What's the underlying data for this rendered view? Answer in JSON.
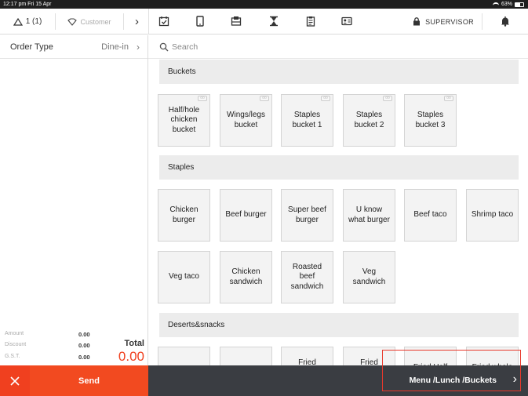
{
  "status_bar": {
    "time_date": "12:17 pm  Fri 15 Apr",
    "battery": "63%",
    "battery_level": 0.63
  },
  "topbar": {
    "table_label": "1 (1)",
    "customer_label": "Customer",
    "supervisor_label": "SUPERVISOR",
    "icons": [
      "calendar-check-icon",
      "tablet-icon",
      "cash-drawer-icon",
      "hourglass-icon",
      "clipboard-icon",
      "id-card-icon"
    ]
  },
  "order": {
    "type_label": "Order Type",
    "type_value": "Dine-in"
  },
  "totals": {
    "amount_label": "Amount",
    "amount_value": "0.00",
    "discount_label": "Discount",
    "discount_value": "0.00",
    "gst_label": "G.S.T.",
    "gst_value": "0.00",
    "total_label": "Total",
    "total_value": "0.00"
  },
  "search": {
    "placeholder": "Search"
  },
  "sections": [
    {
      "title": "Buckets",
      "items": [
        "Half/hole chicken bucket",
        "Wings/legs bucket",
        "Staples bucket 1",
        "Staples bucket 2",
        "Staples bucket 3"
      ]
    },
    {
      "title": "Staples",
      "items": [
        "Chicken burger",
        "Beef burger",
        "Super beef burger",
        "U know what burger",
        "Beef taco",
        "Shrimp taco",
        "Veg taco",
        "Chicken sandwich",
        "Roasted beef sandwich",
        "Veg sandwich"
      ]
    },
    {
      "title": "Deserts&snacks",
      "items": [
        "",
        "",
        "Fried",
        "Fried",
        "Fried Half",
        "Fried whole"
      ]
    }
  ],
  "bottom": {
    "send_label": "Send",
    "breadcrumb": "Menu /Lunch /Buckets"
  },
  "colors": {
    "accent": "#f24a20",
    "bottom_bar": "#3a3d42",
    "tile_bg": "#f3f3f3",
    "section_bg": "#ececec"
  }
}
